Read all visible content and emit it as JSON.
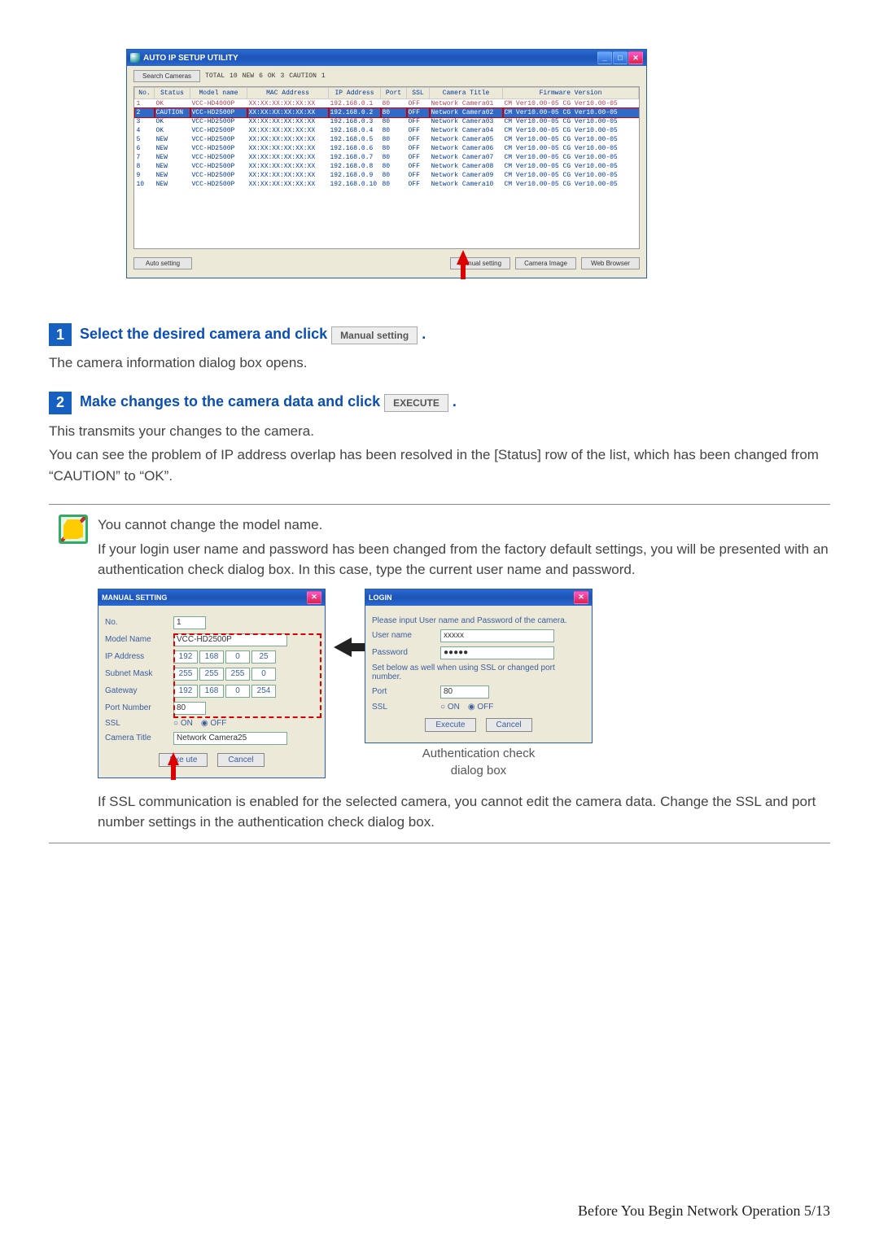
{
  "utility": {
    "title": "AUTO IP SETUP UTILITY",
    "search_btn": "Search Cameras",
    "stats": {
      "total_label": "TOTAL",
      "total": "10",
      "new_label": "NEW",
      "new": "6",
      "ok_label": "OK",
      "ok": "3",
      "caution_label": "CAUTION",
      "caution": "1"
    },
    "columns": [
      "No.",
      "Status",
      "Model name",
      "MAC Address",
      "IP Address",
      "Port",
      "SSL",
      "Camera Title",
      "Firmware Version"
    ],
    "rows": [
      {
        "no": "1",
        "status": "OK",
        "model": "VCC-HD4000P",
        "mac": "XX:XX:XX:XX:XX:XX",
        "ip": "192.168.0.1",
        "port": "80",
        "ssl": "OFF",
        "title": "Network Camera01",
        "fw": "CM Ver10.00-05 CG Ver10.00-05",
        "cls": "row-pink"
      },
      {
        "no": "2",
        "status": "CAUTION",
        "model": "VCC-HD2500P",
        "mac": "XX:XX:XX:XX:XX:XX",
        "ip": "192.168.0.2",
        "port": "80",
        "ssl": "OFF",
        "title": "Network Camera02",
        "fw": "CM Ver10.00-05 CG Ver10.00-05",
        "cls": "highlight outline"
      },
      {
        "no": "3",
        "status": "OK",
        "model": "VCC-HD2500P",
        "mac": "XX:XX:XX:XX:XX:XX",
        "ip": "192.168.0.3",
        "port": "80",
        "ssl": "OFF",
        "title": "Network Camera03",
        "fw": "CM Ver10.00-05 CG Ver10.00-05",
        "cls": "row-ok"
      },
      {
        "no": "4",
        "status": "OK",
        "model": "VCC-HD2500P",
        "mac": "XX:XX:XX:XX:XX:XX",
        "ip": "192.168.0.4",
        "port": "80",
        "ssl": "OFF",
        "title": "Network Camera04",
        "fw": "CM Ver10.00-05 CG Ver10.00-05",
        "cls": "row-ok"
      },
      {
        "no": "5",
        "status": "NEW",
        "model": "VCC-HD2500P",
        "mac": "XX:XX:XX:XX:XX:XX",
        "ip": "192.168.0.5",
        "port": "80",
        "ssl": "OFF",
        "title": "Network Camera05",
        "fw": "CM Ver10.00-05 CG Ver10.00-05",
        "cls": "row-ok"
      },
      {
        "no": "6",
        "status": "NEW",
        "model": "VCC-HD2500P",
        "mac": "XX:XX:XX:XX:XX:XX",
        "ip": "192.168.0.6",
        "port": "80",
        "ssl": "OFF",
        "title": "Network Camera06",
        "fw": "CM Ver10.00-05 CG Ver10.00-05",
        "cls": "row-ok"
      },
      {
        "no": "7",
        "status": "NEW",
        "model": "VCC-HD2500P",
        "mac": "XX:XX:XX:XX:XX:XX",
        "ip": "192.168.0.7",
        "port": "80",
        "ssl": "OFF",
        "title": "Network Camera07",
        "fw": "CM Ver10.00-05 CG Ver10.00-05",
        "cls": "row-ok"
      },
      {
        "no": "8",
        "status": "NEW",
        "model": "VCC-HD2500P",
        "mac": "XX:XX:XX:XX:XX:XX",
        "ip": "192.168.0.8",
        "port": "80",
        "ssl": "OFF",
        "title": "Network Camera08",
        "fw": "CM Ver10.00-05 CG Ver10.00-05",
        "cls": "row-ok"
      },
      {
        "no": "9",
        "status": "NEW",
        "model": "VCC-HD2500P",
        "mac": "XX:XX:XX:XX:XX:XX",
        "ip": "192.168.0.9",
        "port": "80",
        "ssl": "OFF",
        "title": "Network Camera09",
        "fw": "CM Ver10.00-05 CG Ver10.00-05",
        "cls": "row-ok"
      },
      {
        "no": "10",
        "status": "NEW",
        "model": "VCC-HD2500P",
        "mac": "XX:XX:XX:XX:XX:XX",
        "ip": "192.168.0.10",
        "port": "80",
        "ssl": "OFF",
        "title": "Network Camera10",
        "fw": "CM Ver10.00-05 CG Ver10.00-05",
        "cls": "row-ok"
      }
    ],
    "bottom": {
      "auto": "Auto setting",
      "manual": "Manual setting",
      "camera_image": "Camera Image",
      "web_browser": "Web Browser"
    }
  },
  "step1": {
    "num": "1",
    "heading_before": "Select the desired camera and click ",
    "btn": "Manual setting",
    "heading_after": " .",
    "text": "The camera information dialog box opens."
  },
  "step2": {
    "num": "2",
    "heading_before": "Make changes to the camera data and click ",
    "btn": "EXECUTE",
    "heading_after": " .",
    "text1": "This transmits your changes to the camera.",
    "text2": "You can see the problem of IP address overlap has been resolved in the [Status] row of the list, which has been changed from “CAUTION” to “OK”."
  },
  "note": {
    "p1": "You cannot change the model name.",
    "p2": "If your login user name and password has been changed from the factory default settings, you will be presented with an authentication check dialog box. In this case, type the current user name and password.",
    "p3": "If SSL communication is enabled for the selected camera, you cannot edit the camera data. Change the SSL and port number settings in the authentication check dialog box."
  },
  "manual_dialog": {
    "title": "MANUAL SETTING",
    "no_lbl": "No.",
    "no_val": "1",
    "model_lbl": "Model Name",
    "model_val": "VCC-HD2500P",
    "ip_lbl": "IP Address",
    "ip": [
      "192",
      "168",
      "0",
      "25"
    ],
    "mask_lbl": "Subnet Mask",
    "mask": [
      "255",
      "255",
      "255",
      "0"
    ],
    "gw_lbl": "Gateway",
    "gw": [
      "192",
      "168",
      "0",
      "254"
    ],
    "port_lbl": "Port Number",
    "port_val": "80",
    "ssl_lbl": "SSL",
    "ssl_on": "ON",
    "ssl_off": "OFF",
    "title_lbl": "Camera Title",
    "title_val": "Network Camera25",
    "exec": "Exe ute",
    "cancel": "Cancel"
  },
  "login_dialog": {
    "title": "LOGIN",
    "prompt": "Please input User name and Password of the camera.",
    "user_lbl": "User name",
    "user_val": "xxxxx",
    "pass_lbl": "Password",
    "pass_val": "●●●●●",
    "note2": "Set below as well when using SSL or changed port number.",
    "port_lbl": "Port",
    "port_val": "80",
    "ssl_lbl": "SSL",
    "ssl_on": "ON",
    "ssl_off": "OFF",
    "exec": "Execute",
    "cancel": "Cancel",
    "caption1": "Authentication check",
    "caption2": "dialog box"
  },
  "footer": "Before You Begin Network Operation 5/13",
  "winctl": {
    "min": "_",
    "max": "□",
    "close": "✕"
  }
}
